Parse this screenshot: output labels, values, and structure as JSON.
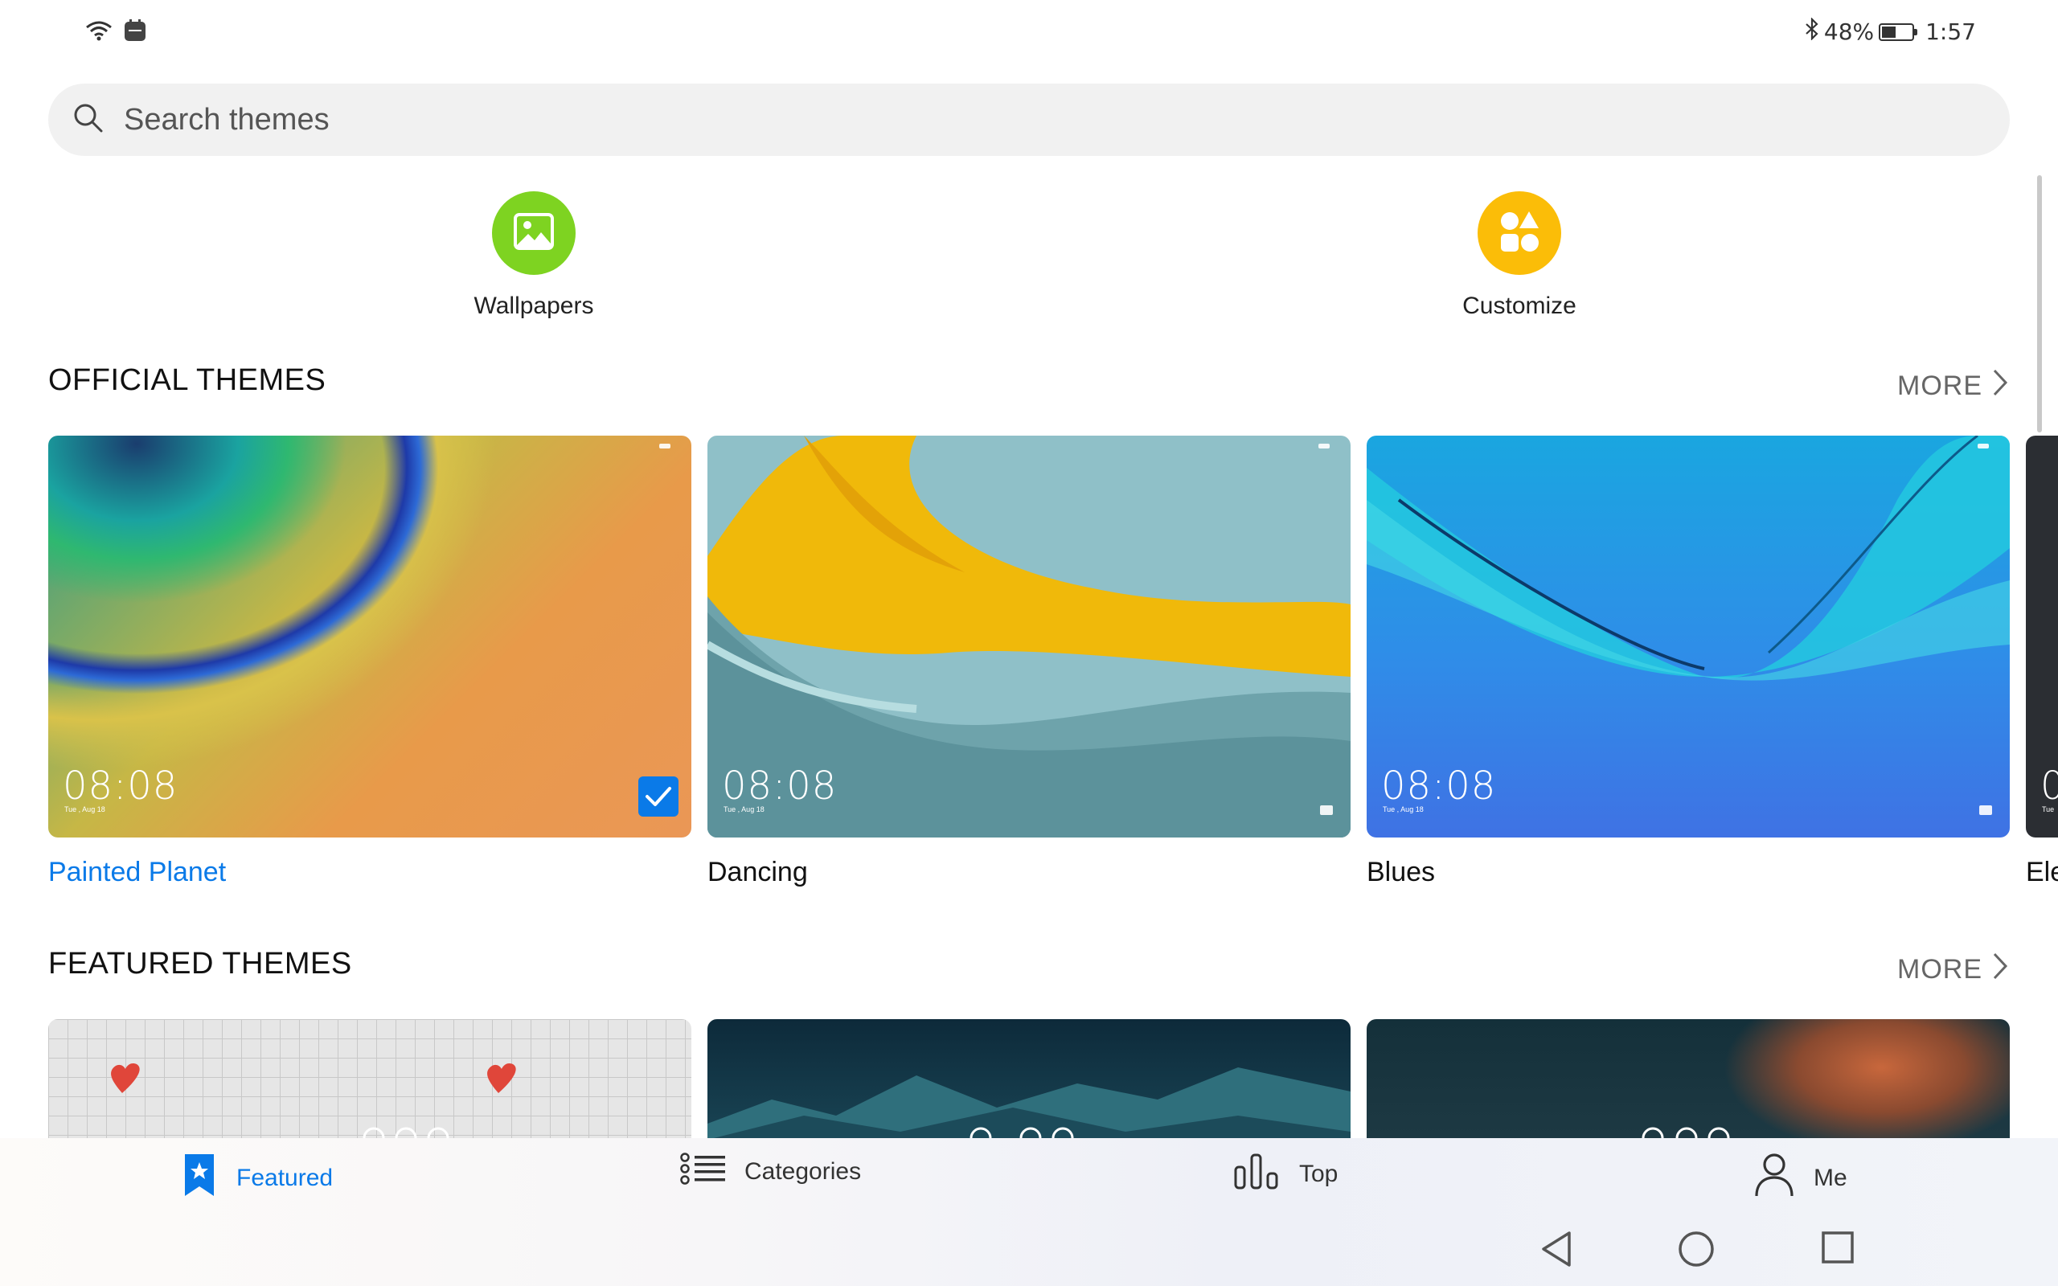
{
  "status": {
    "battery_percent": "48%",
    "battery_level": 0.48,
    "time": "1:57",
    "icons": [
      "wifi-icon",
      "notification-app-icon",
      "bluetooth-icon",
      "battery-icon"
    ]
  },
  "search": {
    "placeholder": "Search themes"
  },
  "quick_actions": [
    {
      "label": "Wallpapers",
      "icon": "image-icon",
      "color": "#7ed321"
    },
    {
      "label": "Customize",
      "icon": "shapes-icon",
      "color": "#fbbd08"
    }
  ],
  "sections": {
    "official": {
      "title": "OFFICIAL THEMES",
      "more_label": "MORE",
      "cards": [
        {
          "title": "Painted Planet",
          "time": "08:08",
          "date": "Tue , Aug 18",
          "selected": true
        },
        {
          "title": "Dancing",
          "time": "08:08",
          "date": "Tue , Aug 18",
          "selected": false
        },
        {
          "title": "Blues",
          "time": "08:08",
          "date": "Tue , Aug 18",
          "selected": false
        },
        {
          "title": "Ele",
          "time": "0",
          "date": "Tue",
          "selected": false
        }
      ]
    },
    "featured": {
      "title": "FEATURED THEMES",
      "more_label": "MORE"
    }
  },
  "bottom_nav": {
    "items": [
      {
        "label": "Featured",
        "icon": "bookmark-star-icon",
        "active": true
      },
      {
        "label": "Categories",
        "icon": "list-icon",
        "active": false
      },
      {
        "label": "Top",
        "icon": "bar-chart-icon",
        "active": false
      },
      {
        "label": "Me",
        "icon": "person-icon",
        "active": false
      }
    ]
  },
  "colors": {
    "accent": "#0a7ae8"
  }
}
